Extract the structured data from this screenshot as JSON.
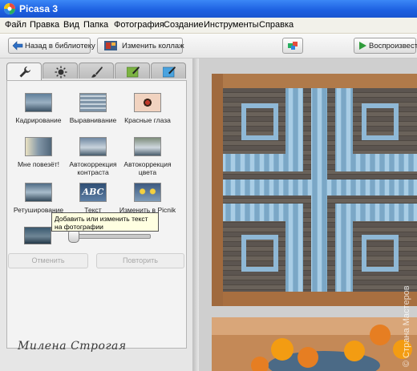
{
  "window": {
    "title": "Picasa 3"
  },
  "menu": [
    "Файл",
    "Правка",
    "Вид",
    "Папка",
    "Фотография",
    "Создание",
    "Инструменты",
    "Справка"
  ],
  "toolbar": {
    "back_label": "Назад в библиотеку",
    "collage_label": "Изменить коллаж",
    "play_label": "Воспроизвести"
  },
  "tabs": [
    {
      "icon": "wrench-icon"
    },
    {
      "icon": "sun-icon"
    },
    {
      "icon": "brush-icon"
    },
    {
      "icon": "green-brush-icon"
    },
    {
      "icon": "blue-brush-icon"
    }
  ],
  "tools": [
    {
      "label": "Кадрирование"
    },
    {
      "label": "Выравнивание"
    },
    {
      "label": "Красные глаза"
    },
    {
      "label": "Мне повезёт!"
    },
    {
      "label": "Автокоррекция контраста"
    },
    {
      "label": "Автокоррекция цвета"
    },
    {
      "label": "Ретуширование"
    },
    {
      "label": "Текст"
    },
    {
      "label": "Изменить в Picnik"
    }
  ],
  "text_thumb": "ABC",
  "tooltip": "Добавить или изменить текст на фотографии",
  "undo_label": "Отменить",
  "redo_label": "Повторить",
  "signature": "Милена Строгая",
  "watermark": "© Страна Мастеров"
}
